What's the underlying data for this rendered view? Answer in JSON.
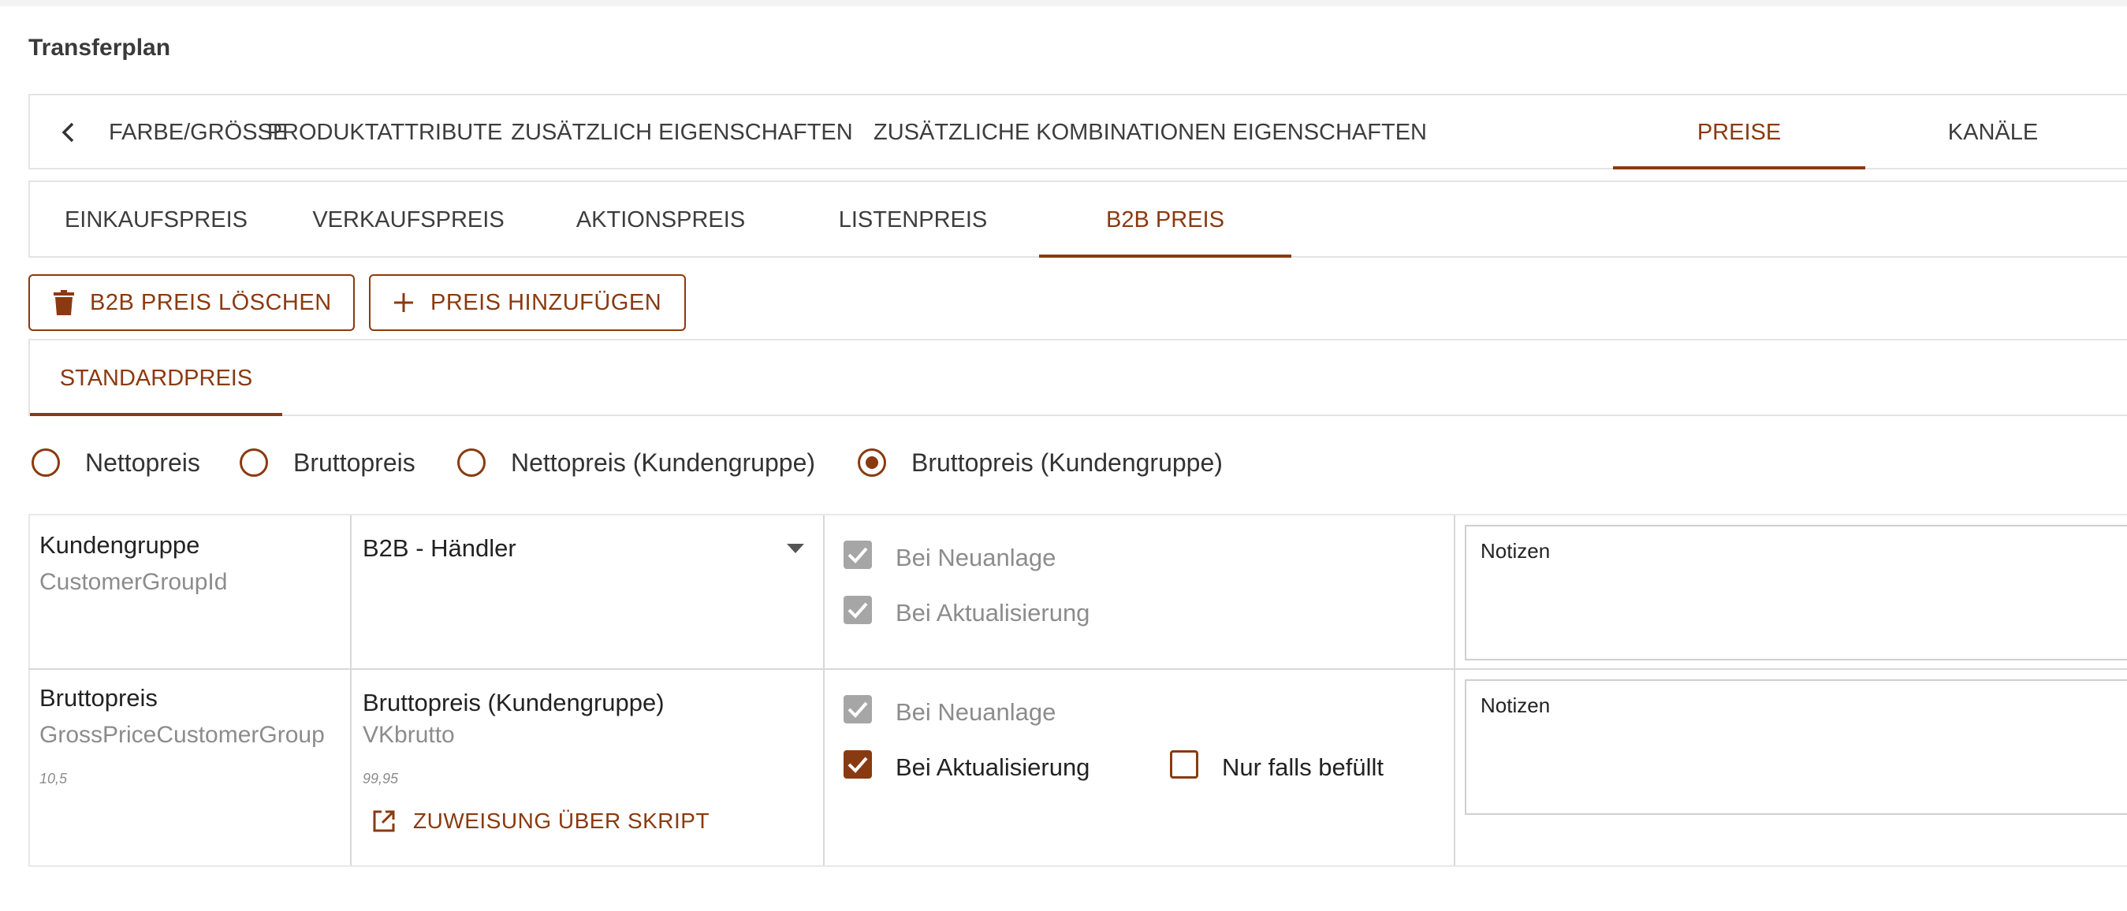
{
  "page_title": "Transferplan",
  "main_tabs": [
    {
      "label": "FARBE/GRÖSSE"
    },
    {
      "label": "PRODUKTATTRIBUTE"
    },
    {
      "label": "ZUSÄTZLICH EIGENSCHAFTEN"
    },
    {
      "label": "ZUSÄTZLICHE KOMBINATIONEN EIGENSCHAFTEN"
    },
    {
      "label": "PREISE",
      "active": true
    },
    {
      "label": "KANÄLE"
    }
  ],
  "price_tabs": [
    {
      "label": "EINKAUFSPREIS"
    },
    {
      "label": "VERKAUFSPREIS"
    },
    {
      "label": "AKTIONSPREIS"
    },
    {
      "label": "LISTENPREIS"
    },
    {
      "label": "B2B PREIS",
      "active": true
    }
  ],
  "actions": {
    "delete_label": "B2B PREIS LÖSCHEN",
    "add_label": "PREIS HINZUFÜGEN"
  },
  "sub_tabs": [
    {
      "label": "STANDARDPREIS",
      "active": true
    }
  ],
  "price_type_options": [
    {
      "label": "Nettopreis",
      "selected": false
    },
    {
      "label": "Bruttopreis",
      "selected": false
    },
    {
      "label": "Nettopreis (Kundengruppe)",
      "selected": false
    },
    {
      "label": "Bruttopreis (Kundengruppe)",
      "selected": true
    }
  ],
  "rows": [
    {
      "field_label": "Kundengruppe",
      "field_key": "CustomerGroupId",
      "value_select": "B2B - Händler",
      "checkboxes": [
        {
          "label": "Bei Neuanlage",
          "checked": true,
          "disabled": true
        },
        {
          "label": "Bei Aktualisierung",
          "checked": true,
          "disabled": true
        }
      ],
      "notes_placeholder": "Notizen"
    },
    {
      "field_label": "Bruttopreis",
      "field_key": "GrossPriceCustomerGroup",
      "field_sample": "10,5",
      "value_label": "Bruttopreis (Kundengruppe)",
      "value_key": "VKbrutto",
      "value_sample": "99,95",
      "script_link": "ZUWEISUNG ÜBER SKRIPT",
      "checkboxes": [
        {
          "label": "Bei Neuanlage",
          "checked": true,
          "disabled": true
        },
        {
          "label": "Bei Aktualisierung",
          "checked": true,
          "disabled": false
        },
        {
          "label": "Nur falls befüllt",
          "checked": false,
          "disabled": false
        }
      ],
      "notes_placeholder": "Notizen"
    }
  ],
  "colors": {
    "accent": "#8a3a10",
    "disabled": "#a6a6a6"
  },
  "icons": [
    "chevron-left-icon",
    "trash-icon",
    "plus-icon",
    "check-icon",
    "dropdown-arrow-icon",
    "open-external-icon"
  ]
}
